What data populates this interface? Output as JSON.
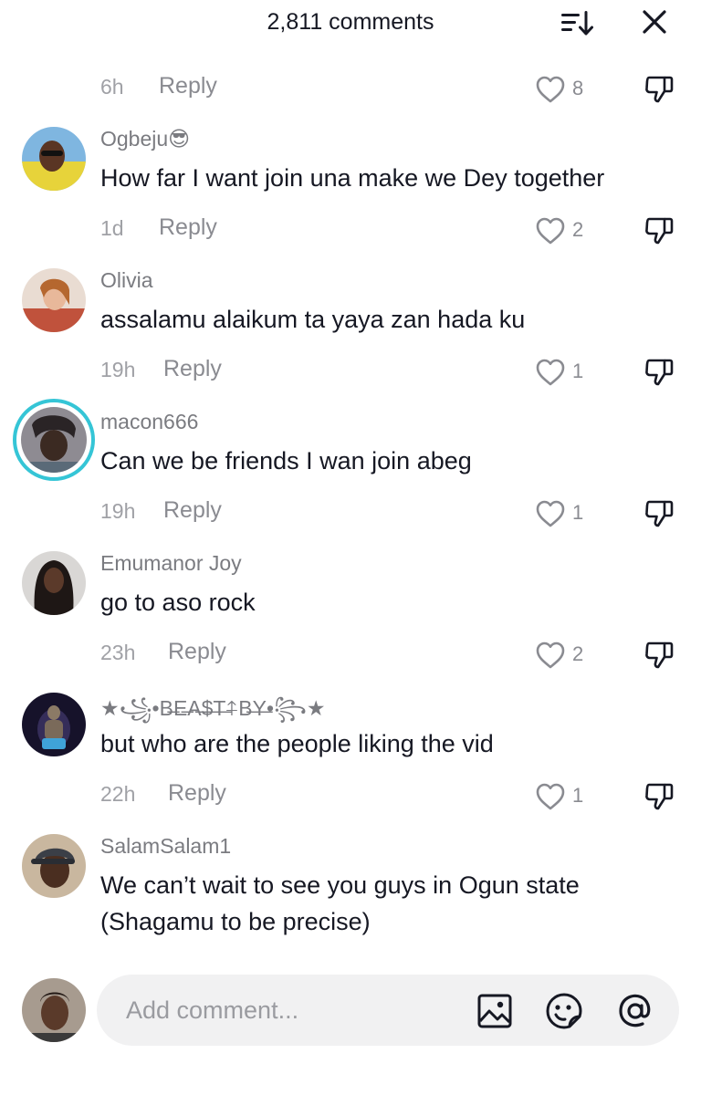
{
  "header": {
    "title": "2,811 comments",
    "sort_icon": "sort-icon",
    "close_icon": "close-icon"
  },
  "top_row": {
    "time": "6h",
    "reply": "Reply",
    "likes": "8"
  },
  "comments": [
    {
      "username": "Ogbeju😎",
      "text": "How far I want join una make we Dey together",
      "time": "1d",
      "reply": "Reply",
      "likes": "2"
    },
    {
      "username": "Olivia",
      "text": "assalamu alaikum ta yaya zan hada ku",
      "time": "19h",
      "reply": "Reply",
      "likes": "1"
    },
    {
      "username": "macon666",
      "text": "Can we be friends I wan join abeg",
      "time": "19h",
      "reply": "Reply",
      "likes": "1"
    },
    {
      "username": "Emumanor Joy",
      "text": "go to aso rock",
      "time": "23h",
      "reply": "Reply",
      "likes": "2"
    },
    {
      "username": "★꧁•B̶E̶A̶$̶T̶⍏B̶Y̶•꧂★",
      "text": "but who are the people liking the vid",
      "time": "22h",
      "reply": "Reply",
      "likes": "1"
    },
    {
      "username": "SalamSalam1",
      "text": "We can’t wait to see you guys in Ogun state (Shagamu to be precise)"
    }
  ],
  "compose": {
    "placeholder": "Add comment...",
    "image_icon": "image-icon",
    "emoji_icon": "emoji-icon",
    "mention_icon": "mention-icon"
  },
  "colors": {
    "text_primary": "#161823",
    "text_secondary": "#8a8b91",
    "story_ring": "#35c5d6",
    "input_bg": "#f1f1f2"
  }
}
